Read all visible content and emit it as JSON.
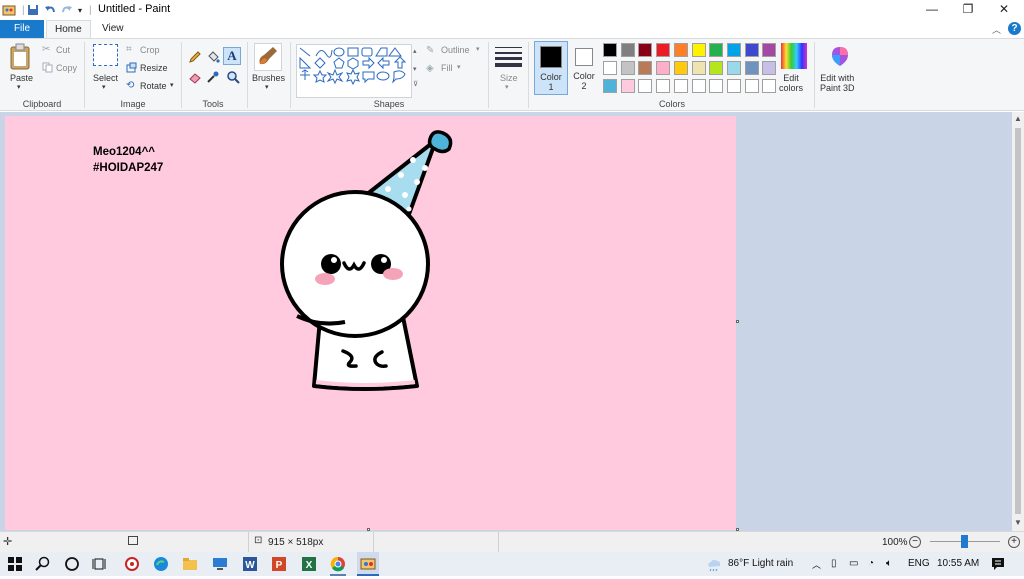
{
  "window": {
    "title": "Untitled - Paint"
  },
  "tabs": {
    "file": "File",
    "home": "Home",
    "view": "View"
  },
  "clipboard": {
    "paste": "Paste",
    "cut": "Cut",
    "copy": "Copy",
    "label": "Clipboard"
  },
  "image_group": {
    "select": "Select",
    "crop": "Crop",
    "resize": "Resize",
    "rotate": "Rotate",
    "label": "Image"
  },
  "tools": {
    "label": "Tools"
  },
  "brushes": {
    "label": "Brushes"
  },
  "shapes": {
    "outline": "Outline",
    "fill": "Fill",
    "label": "Shapes"
  },
  "size": {
    "label": "Size"
  },
  "colors": {
    "color1": "Color\n1",
    "color2": "Color\n2",
    "edit": "Edit\ncolors",
    "label": "Colors",
    "paint3d": "Edit with\nPaint 3D",
    "color1_value": "#000000",
    "color2_value": "#ffffff",
    "palette": [
      [
        "#000000",
        "#7f7f7f",
        "#880015",
        "#ed1c24",
        "#ff7f27",
        "#fff200",
        "#22b14c",
        "#00a2e8",
        "#3f48cc",
        "#a349a4"
      ],
      [
        "#ffffff",
        "#c3c3c3",
        "#b97a57",
        "#ffaec9",
        "#ffc90e",
        "#efe4b0",
        "#b5e61d",
        "#99d9ea",
        "#7092be",
        "#c8bfe7"
      ],
      [
        "#4fb3d9",
        "#ffc9de",
        "#ffffff",
        "#ffffff",
        "#ffffff",
        "#ffffff",
        "#ffffff",
        "#ffffff",
        "#ffffff",
        "#ffffff"
      ]
    ]
  },
  "canvas": {
    "background": "#ffc9de",
    "text_line1": "Meo1204^^",
    "text_line2": "#HOIDAP247"
  },
  "status": {
    "dimensions": "915 × 518px",
    "zoom": "100%"
  },
  "taskbar": {
    "weather": "86°F  Light rain",
    "lang": "ENG",
    "time": "10:55 AM"
  }
}
